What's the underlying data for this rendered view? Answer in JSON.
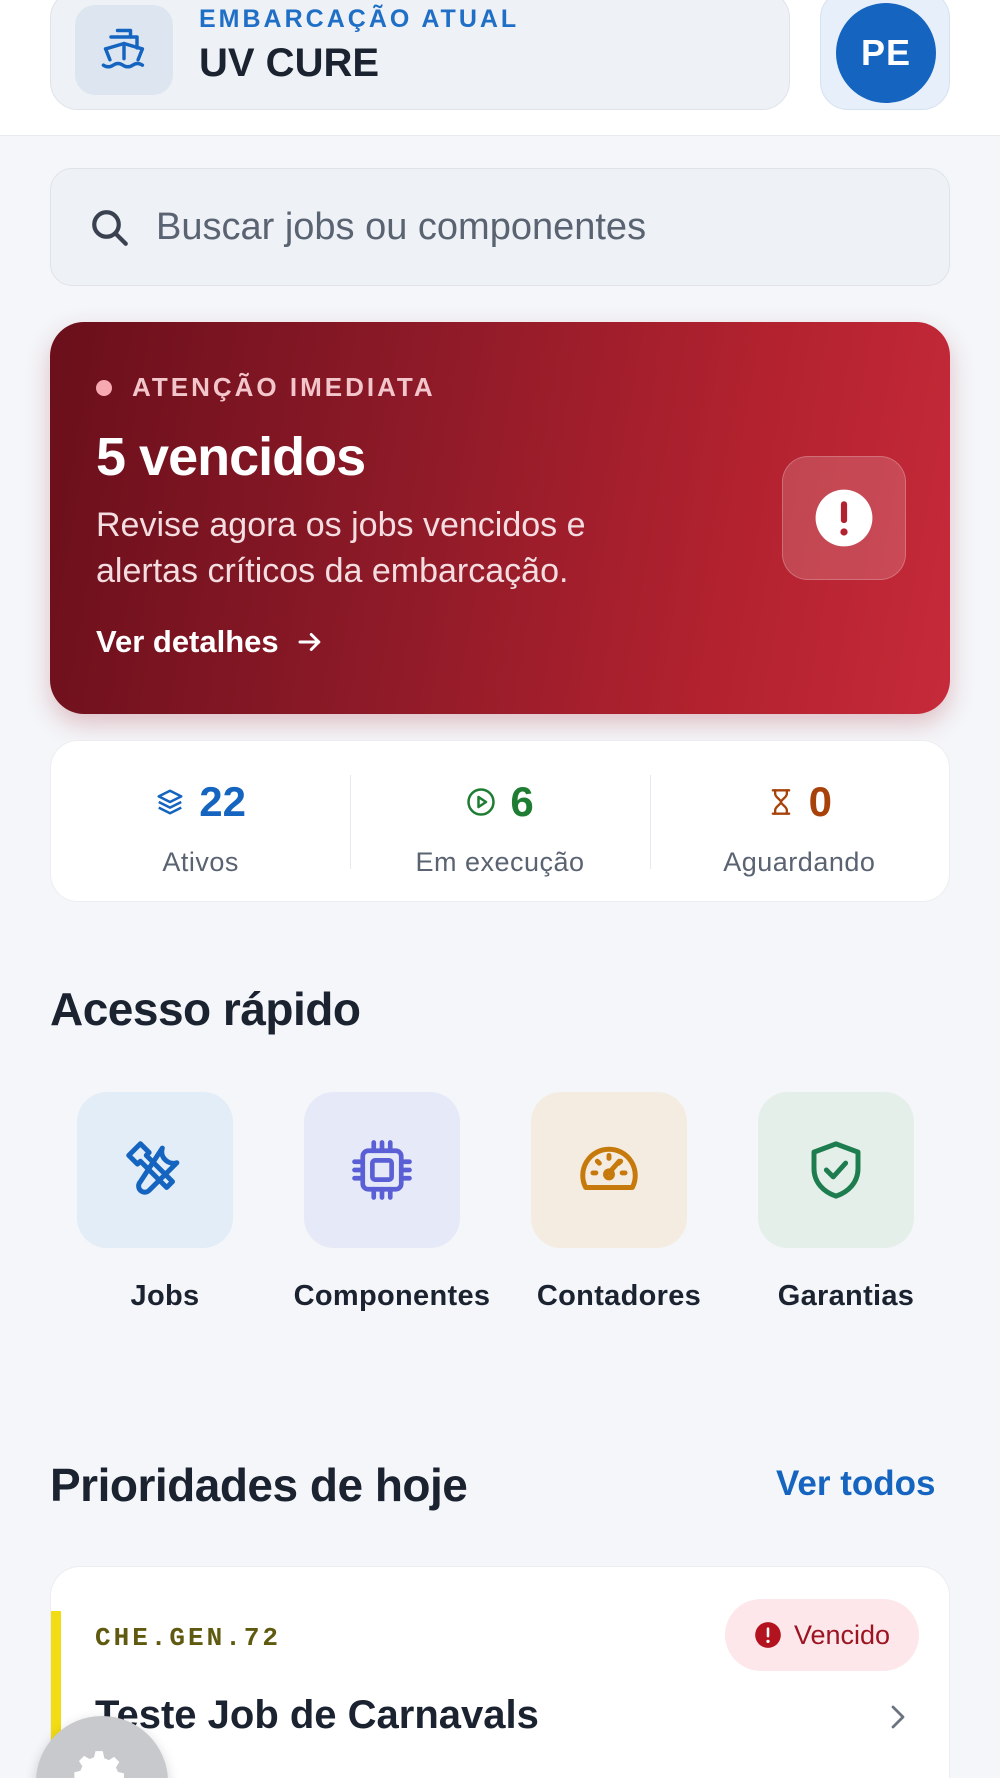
{
  "header": {
    "vessel_kicker": "EMBARCAÇÃO ATUAL",
    "vessel_name": "UV CURE",
    "avatar_initials": "PE",
    "vessel_icon": "ship-icon"
  },
  "search": {
    "placeholder": "Buscar jobs ou componentes",
    "icon": "search-icon"
  },
  "alert": {
    "kicker": "ATENÇÃO IMEDIATA",
    "title": "5 vencidos",
    "description": "Revise agora os jobs vencidos e alertas críticos da embarcação.",
    "link_label": "Ver detalhes",
    "icon": "exclamation-circle-icon",
    "colors": {
      "gradient_start": "#6a0f1b",
      "gradient_end": "#c62a3a"
    }
  },
  "stats": [
    {
      "value": "22",
      "label": "Ativos",
      "icon": "layers-icon",
      "color": "#1565c0"
    },
    {
      "value": "6",
      "label": "Em execução",
      "icon": "play-circle-icon",
      "color": "#1e7d33"
    },
    {
      "value": "0",
      "label": "Aguardando",
      "icon": "hourglass-icon",
      "color": "#a8420b"
    }
  ],
  "quick_access": {
    "title": "Acesso rápido",
    "items": [
      {
        "label": "Jobs",
        "icon": "tools-icon",
        "tile_color": "#e3edf8",
        "icon_color": "#1565c0"
      },
      {
        "label": "Componentes",
        "icon": "chip-icon",
        "tile_color": "#e6e9f7",
        "icon_color": "#5a5fd6"
      },
      {
        "label": "Contadores",
        "icon": "gauge-icon",
        "tile_color": "#f4ece0",
        "icon_color": "#c77a0c"
      },
      {
        "label": "Garantias",
        "icon": "shield-check-icon",
        "tile_color": "#e5efea",
        "icon_color": "#1e7d4f"
      }
    ]
  },
  "priorities": {
    "title": "Prioridades de hoje",
    "see_all_label": "Ver todos",
    "jobs": [
      {
        "code": "CHE.GEN.72",
        "title": "Teste Job de Carnavals",
        "status": "Vencido",
        "stripe_color": "#f2dc14"
      }
    ]
  },
  "fab": {
    "icon": "gear-icon"
  }
}
